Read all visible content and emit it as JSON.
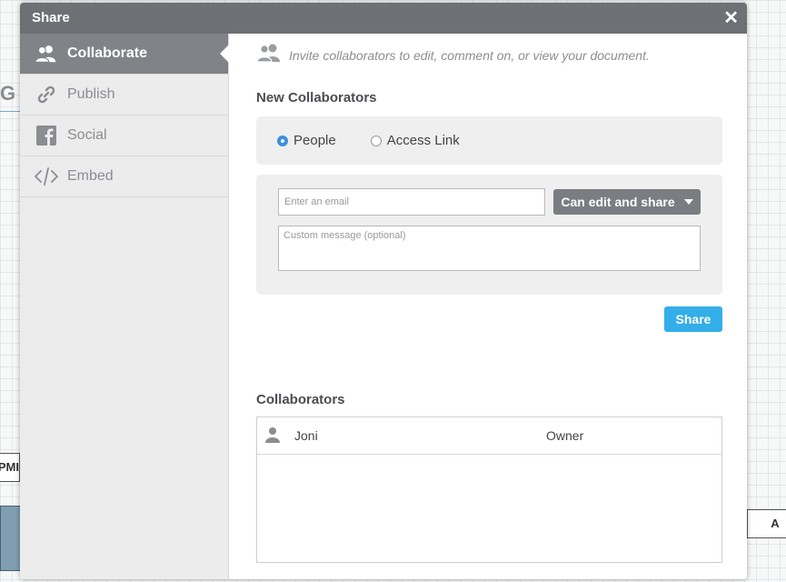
{
  "background": {
    "partial_text_g": "G",
    "partial_text_pm": "PMI",
    "partial_text_a": "A"
  },
  "dialog": {
    "title": "Share",
    "close_glyph": "✕"
  },
  "sidebar": {
    "items": [
      {
        "label": "Collaborate",
        "icon": "users-icon",
        "active": true
      },
      {
        "label": "Publish",
        "icon": "link-icon",
        "active": false
      },
      {
        "label": "Social",
        "icon": "facebook-icon",
        "active": false
      },
      {
        "label": "Embed",
        "icon": "code-icon",
        "active": false
      }
    ]
  },
  "main": {
    "intro_text": "Invite collaborators to edit, comment on, or view your document.",
    "new_collaborators_title": "New Collaborators",
    "radio_options": [
      {
        "label": "People",
        "checked": true
      },
      {
        "label": "Access Link",
        "checked": false
      }
    ],
    "email_placeholder": "Enter an email",
    "permission_label": "Can edit and share",
    "message_placeholder": "Custom message (optional)",
    "share_button_label": "Share",
    "collaborators_title": "Collaborators",
    "collaborators": [
      {
        "name": "Joni",
        "role": "Owner"
      }
    ]
  },
  "colors": {
    "titlebar": "#6d7074",
    "active_nav": "#808387",
    "accent_blue": "#33aee8",
    "radio_checked": "#3a8fe0"
  }
}
